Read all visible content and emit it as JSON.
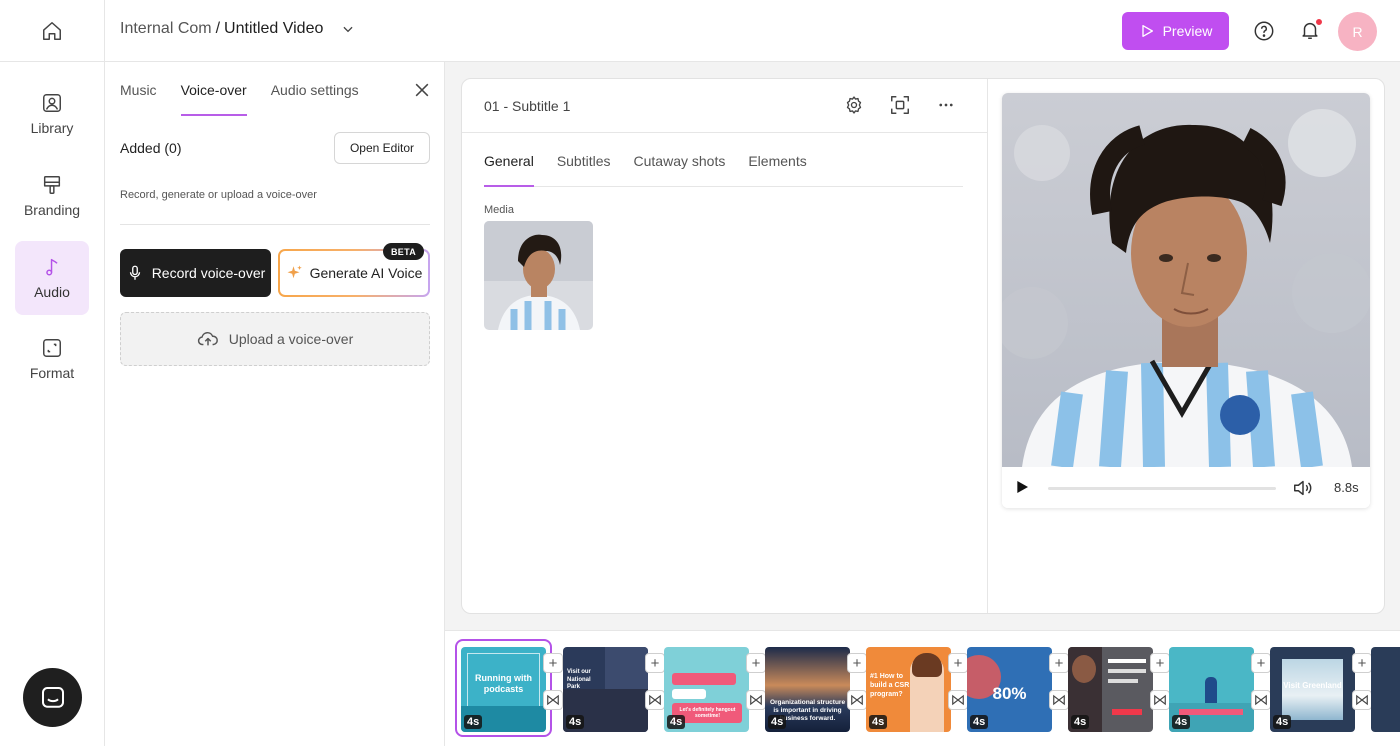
{
  "header": {
    "workspace": "Internal Com",
    "separator": " / ",
    "title": "Untitled Video",
    "preview_label": "Preview",
    "avatar_initial": "R"
  },
  "sidebar": {
    "items": [
      {
        "label": "Library",
        "icon": "image-icon"
      },
      {
        "label": "Branding",
        "icon": "brush-icon"
      },
      {
        "label": "Audio",
        "icon": "music-note-icon",
        "active": true
      },
      {
        "label": "Format",
        "icon": "resize-icon"
      }
    ]
  },
  "audio_panel": {
    "tabs": [
      {
        "label": "Music"
      },
      {
        "label": "Voice-over",
        "active": true
      },
      {
        "label": "Audio settings"
      }
    ],
    "added_label": "Added (0)",
    "open_editor_label": "Open Editor",
    "hint": "Record, generate or upload a voice-over",
    "record_label": "Record voice-over",
    "generate_label": "Generate AI Voice",
    "beta_badge": "BETA",
    "upload_label": "Upload a voice-over"
  },
  "editor": {
    "scene_title": "01 - Subtitle 1",
    "tabs": [
      {
        "label": "General",
        "active": true
      },
      {
        "label": "Subtitles"
      },
      {
        "label": "Cutaway shots"
      },
      {
        "label": "Elements"
      }
    ],
    "media_label": "Media"
  },
  "player": {
    "duration": "8.8s",
    "progress": 0
  },
  "timeline": {
    "scenes": [
      {
        "text": "Running with podcasts",
        "duration": "4s",
        "selected": true
      },
      {
        "text": "Visit our National Park",
        "duration": "4s"
      },
      {
        "text": "Let's definitely hangout sometime!",
        "duration": "4s"
      },
      {
        "text": "Organizational structure is important in driving business forward.",
        "duration": "4s"
      },
      {
        "text": "#1 How to build a CSR program?",
        "duration": "4s"
      },
      {
        "text": "80%",
        "duration": "4s"
      },
      {
        "text": "",
        "duration": "4s"
      },
      {
        "text": "",
        "duration": "4s"
      },
      {
        "text": "Visit Greenland",
        "duration": "4s"
      }
    ]
  },
  "colors": {
    "accent": "#c04ef0",
    "active_bg": "#f3e6fb",
    "notification": "#f0384a",
    "avatar": "#f7b3c3"
  }
}
